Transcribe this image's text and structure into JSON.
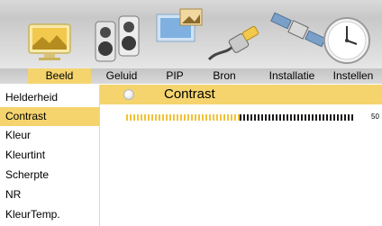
{
  "tabs": [
    {
      "label": "Beeld",
      "active": true
    },
    {
      "label": "Geluid",
      "active": false
    },
    {
      "label": "PIP",
      "active": false
    },
    {
      "label": "Bron",
      "active": false
    },
    {
      "label": "Installatie",
      "active": false
    },
    {
      "label": "Instellen",
      "active": false
    }
  ],
  "icons": [
    "picture-icon",
    "speakers-icon",
    "pip-icon",
    "source-plug-icon",
    "satellite-icon",
    "clock-icon"
  ],
  "menu": {
    "items": [
      {
        "label": "Helderheid",
        "selected": false
      },
      {
        "label": "Contrast",
        "selected": true
      },
      {
        "label": "Kleur",
        "selected": false
      },
      {
        "label": "Kleurtint",
        "selected": false
      },
      {
        "label": "Scherpte",
        "selected": false
      },
      {
        "label": "NR",
        "selected": false
      },
      {
        "label": "KleurTemp.",
        "selected": false
      }
    ]
  },
  "panel": {
    "title": "Contrast",
    "slider_value": "50",
    "slider_fraction": 0.5
  },
  "colors": {
    "accent": "#f5d46e",
    "slider_fill": "#f1c23a",
    "slider_empty": "#1a1a1a"
  }
}
